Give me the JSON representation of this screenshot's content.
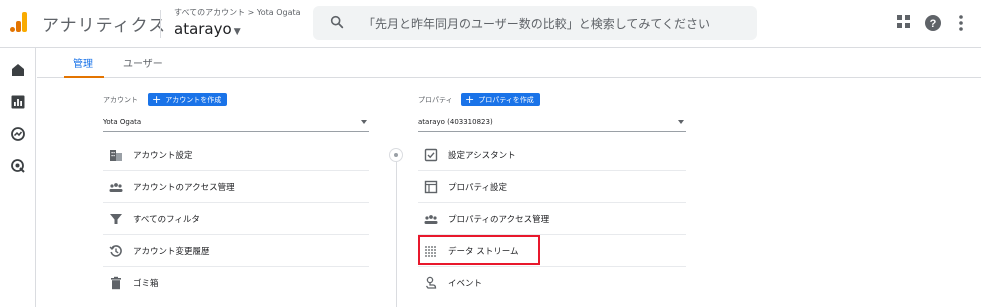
{
  "header": {
    "app_title": "アナリティクス",
    "account_crumb": "すべてのアカウント > Yota Ogata",
    "account_name": "atarayo",
    "search_placeholder": "「先月と昨年同月のユーザー数の比較」と検索してみてください",
    "icons": [
      "analytics-logo",
      "search-icon",
      "apps-icon",
      "help-icon",
      "more-vert-icon"
    ]
  },
  "rail": {
    "items": [
      "home-icon",
      "reports-icon",
      "explore-icon",
      "advertising-icon"
    ]
  },
  "tabs": [
    {
      "label": "管理",
      "active": true
    },
    {
      "label": "ユーザー",
      "active": false
    }
  ],
  "account_column": {
    "label": "アカウント",
    "create_button": "アカウントを作成",
    "selected": "Yota Ogata",
    "items": [
      {
        "label": "アカウント設定",
        "icon": "building-icon"
      },
      {
        "label": "アカウントのアクセス管理",
        "icon": "people-icon"
      },
      {
        "label": "すべてのフィルタ",
        "icon": "filter-icon"
      },
      {
        "label": "アカウント変更履歴",
        "icon": "history-icon"
      },
      {
        "label": "ゴミ箱",
        "icon": "trash-icon"
      }
    ]
  },
  "property_column": {
    "label": "プロパティ",
    "create_button": "プロパティを作成",
    "selected": "atarayo (403310823)",
    "items": [
      {
        "label": "設定アシスタント",
        "icon": "checklist-icon"
      },
      {
        "label": "プロパティ設定",
        "icon": "property-settings-icon"
      },
      {
        "label": "プロパティのアクセス管理",
        "icon": "people-icon"
      },
      {
        "label": "データ ストリーム",
        "icon": "data-stream-icon",
        "highlighted": true
      },
      {
        "label": "イベント",
        "icon": "event-icon"
      }
    ]
  },
  "colors": {
    "accent": "#1a73e8",
    "tab_indicator": "#e37400",
    "highlight_box": "#e8182c"
  }
}
